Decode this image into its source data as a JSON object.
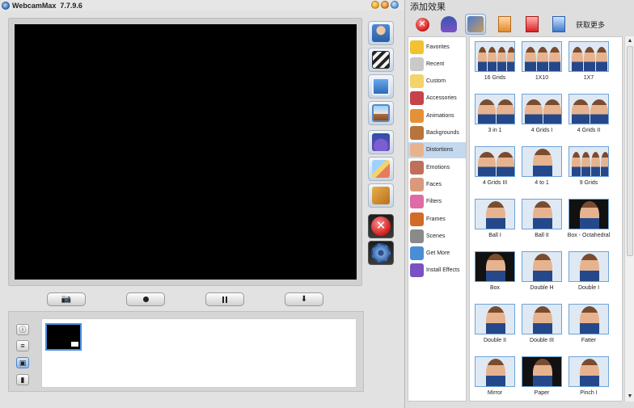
{
  "window": {
    "app_name": "WebcamMax",
    "version": "7.7.9.6",
    "controls": [
      "minimize",
      "maximize",
      "close"
    ]
  },
  "side_tools": [
    {
      "name": "face-tool",
      "icon": "user-icon"
    },
    {
      "name": "video-tool",
      "icon": "clapper-icon"
    },
    {
      "name": "window-tool",
      "icon": "window-icon"
    },
    {
      "name": "picture-tool",
      "icon": "picture-icon"
    },
    {
      "name": "effects-tool",
      "icon": "wizard-icon"
    },
    {
      "name": "draw-tool",
      "icon": "pencil-icon"
    },
    {
      "name": "gift-tool",
      "icon": "box-icon"
    },
    {
      "name": "close-tool",
      "icon": "close-icon"
    },
    {
      "name": "settings-tool",
      "icon": "gear-icon"
    }
  ],
  "capture_controls": [
    {
      "name": "snapshot",
      "icon": "camera-icon"
    },
    {
      "name": "record",
      "icon": "record-icon"
    },
    {
      "name": "pause",
      "icon": "pause-icon"
    },
    {
      "name": "download",
      "icon": "download-arrow-icon"
    }
  ],
  "view_controls": [
    "info",
    "list",
    "thumbnails",
    "film"
  ],
  "effects_panel": {
    "title": "添加效果",
    "toolbar": [
      {
        "name": "remove-effect",
        "icon": "close-icon"
      },
      {
        "name": "wizard",
        "icon": "wizard-icon"
      },
      {
        "name": "face-effects",
        "icon": "face-icon"
      },
      {
        "name": "add-effect",
        "icon": "add-doc-icon"
      },
      {
        "name": "delete-effect",
        "icon": "pdf-doc-icon"
      },
      {
        "name": "edit-effect",
        "icon": "text-doc-icon"
      }
    ],
    "get_more_label": "获取更多",
    "categories": [
      {
        "label": "Favorites",
        "color": "#f1c232"
      },
      {
        "label": "Recent",
        "color": "#c9c9c9"
      },
      {
        "label": "Custom",
        "color": "#f3d36a"
      },
      {
        "label": "Accessories",
        "color": "#c6434b"
      },
      {
        "label": "Animations",
        "color": "#e69138"
      },
      {
        "label": "Backgrounds",
        "color": "#b8743b"
      },
      {
        "label": "Distortions",
        "color": "#e7b38f",
        "active": true
      },
      {
        "label": "Emotions",
        "color": "#c0705a"
      },
      {
        "label": "Faces",
        "color": "#d89a7a"
      },
      {
        "label": "Filters",
        "color": "#e06aa8"
      },
      {
        "label": "Frames",
        "color": "#d46a2a"
      },
      {
        "label": "Scenes",
        "color": "#8a8a8a"
      },
      {
        "label": "Get More",
        "color": "#4a8fd6"
      },
      {
        "label": "Install Effects",
        "color": "#7a52c4"
      }
    ],
    "effects": [
      "16 Grids",
      "1X10",
      "1X7",
      "3 in 1",
      "4 Grids I",
      "4 Grids II",
      "4 Grids III",
      "4 to 1",
      "9 Grids",
      "Ball I",
      "Ball II",
      "Box - Octahedral",
      "Box",
      "Double H",
      "Double I",
      "Double II",
      "Double III",
      "Fatter",
      "Mirror",
      "Paper",
      "Pinch I"
    ]
  }
}
